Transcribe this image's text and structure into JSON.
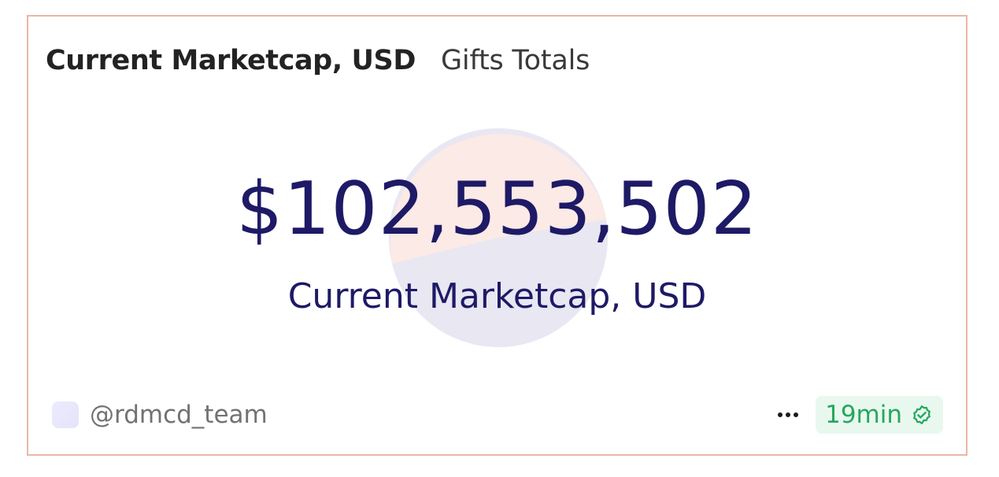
{
  "card": {
    "title": "Current Marketcap, USD",
    "tab": "Gifts Totals"
  },
  "metric": {
    "value": "$102,553,502",
    "label": "Current Marketcap, USD"
  },
  "footer": {
    "author": "@rdmcd_team",
    "more_icon": "more-horizontal-icon",
    "refresh_badge": "19min",
    "verified_icon": "verified-check-icon"
  },
  "colors": {
    "border": "#eab6a6",
    "metric_text": "#1e1a66",
    "pie_top": "#fbeae6",
    "pie_bottom": "#e8e7f2",
    "badge_bg": "#e9f8ef",
    "badge_text": "#25a85f"
  }
}
